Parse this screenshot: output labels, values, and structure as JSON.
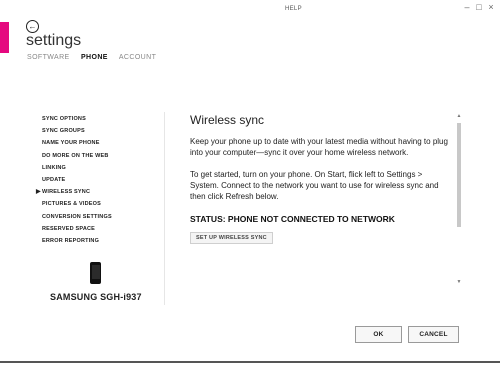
{
  "window": {
    "help_label": "HELP",
    "minimize_glyph": "–",
    "maximize_glyph": "□",
    "close_glyph": "×",
    "accent_color": "#e5097f"
  },
  "header": {
    "back_glyph": "←",
    "title": "settings",
    "tabs": [
      {
        "label": "SOFTWARE",
        "active": false
      },
      {
        "label": "PHONE",
        "active": true
      },
      {
        "label": "ACCOUNT",
        "active": false
      }
    ]
  },
  "sidebar": {
    "selected_marker": "▶",
    "items": [
      {
        "label": "SYNC OPTIONS"
      },
      {
        "label": "SYNC GROUPS"
      },
      {
        "label": "NAME YOUR PHONE"
      },
      {
        "label": "DO MORE ON THE WEB"
      },
      {
        "label": "LINKING"
      },
      {
        "label": "UPDATE"
      },
      {
        "label": "WIRELESS SYNC",
        "selected": true
      },
      {
        "label": "PICTURES & VIDEOS"
      },
      {
        "label": "CONVERSION SETTINGS"
      },
      {
        "label": "RESERVED SPACE"
      },
      {
        "label": "ERROR REPORTING"
      }
    ],
    "device_name": "SAMSUNG SGH-i937"
  },
  "content": {
    "heading": "Wireless sync",
    "paragraph1": "Keep your phone up to date with your latest media without having to plug into your computer—sync it over your home wireless network.",
    "paragraph2": "To get started, turn on your phone. On Start, flick left to Settings > System. Connect to the network you want to use for wireless sync and then click Refresh below.",
    "status": "STATUS: PHONE NOT CONNECTED TO NETWORK",
    "setup_button": "SET UP WIRELESS SYNC"
  },
  "scrollbar": {
    "up_glyph": "▲",
    "down_glyph": "▼"
  },
  "footer": {
    "ok_label": "OK",
    "cancel_label": "CANCEL"
  }
}
